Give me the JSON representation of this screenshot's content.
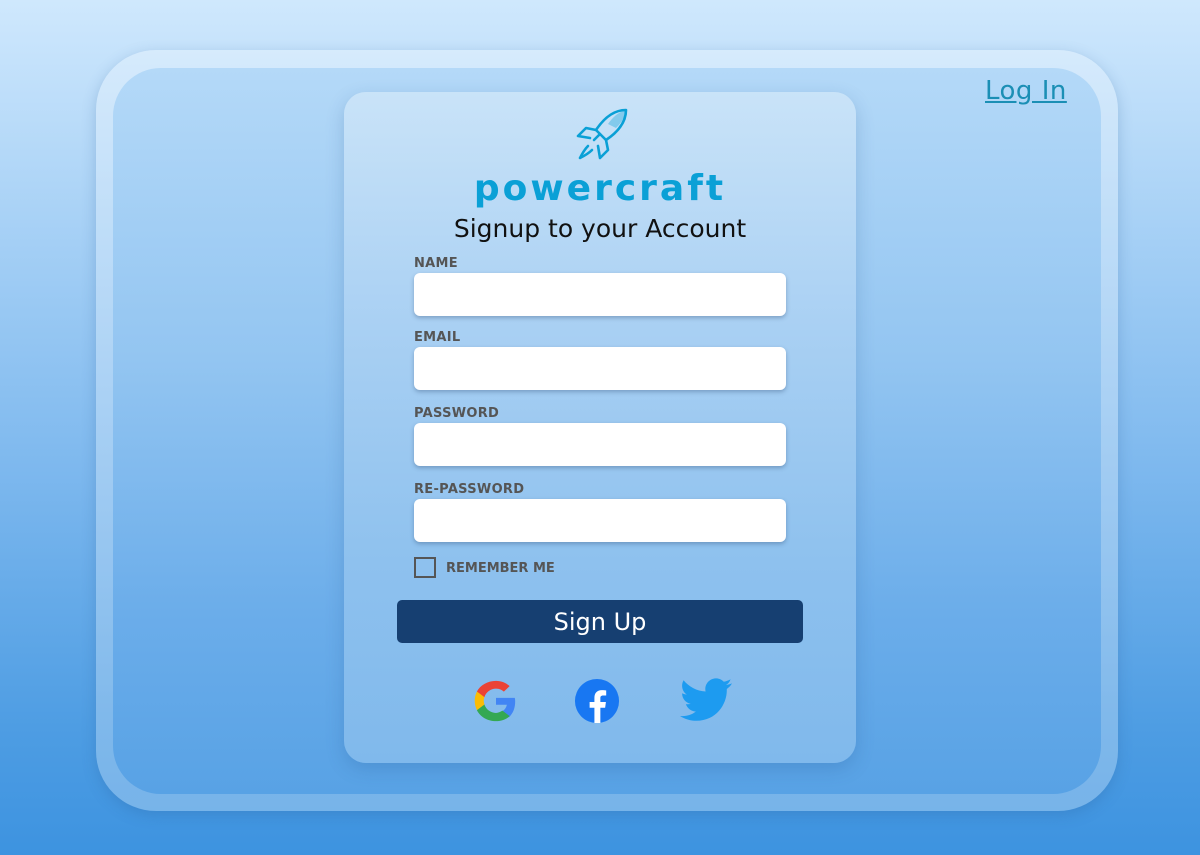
{
  "header": {
    "login_link": "Log In"
  },
  "brand": {
    "name": "powercraft",
    "logo_icon": "rocket-icon"
  },
  "form": {
    "title": "Signup to your Account",
    "fields": [
      {
        "label": "NAME",
        "value": "",
        "placeholder": ""
      },
      {
        "label": "EMAIL",
        "value": "",
        "placeholder": ""
      },
      {
        "label": "PASSWORD",
        "value": "",
        "placeholder": ""
      },
      {
        "label": "RE-PASSWORD",
        "value": "",
        "placeholder": ""
      }
    ],
    "remember_me": {
      "label": "REMEMBER ME",
      "checked": false
    },
    "submit_label": "Sign Up"
  },
  "social": [
    {
      "name": "google-icon"
    },
    {
      "name": "facebook-icon"
    },
    {
      "name": "twitter-icon"
    }
  ],
  "colors": {
    "brand": "#0aa0d6",
    "button": "#163f71",
    "link": "#1b8fb5"
  }
}
